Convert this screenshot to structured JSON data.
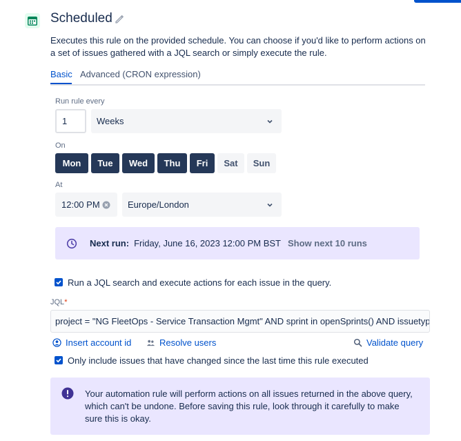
{
  "header": {
    "title": "Scheduled",
    "icon": "calendar-icon",
    "description": "Executes this rule on the provided schedule. You can choose if you'd like to perform actions on a set of issues gathered with a JQL search or simply execute the rule."
  },
  "tabs": [
    {
      "label": "Basic",
      "active": true
    },
    {
      "label": "Advanced (CRON expression)",
      "active": false
    }
  ],
  "schedule": {
    "run_every_label": "Run rule every",
    "interval_value": "1",
    "interval_unit": "Weeks",
    "on_label": "On",
    "days": [
      {
        "label": "Mon",
        "selected": true
      },
      {
        "label": "Tue",
        "selected": true
      },
      {
        "label": "Wed",
        "selected": true
      },
      {
        "label": "Thu",
        "selected": true
      },
      {
        "label": "Fri",
        "selected": true
      },
      {
        "label": "Sat",
        "selected": false
      },
      {
        "label": "Sun",
        "selected": false
      }
    ],
    "at_label": "At",
    "time": "12:00 PM",
    "timezone": "Europe/London"
  },
  "next_run": {
    "label": "Next run:",
    "value": "Friday, June 16, 2023 12:00 PM BST",
    "link": "Show next 10 runs"
  },
  "jql": {
    "checkbox_label": "Run a JQL search and execute actions for each issue in the query.",
    "checkbox_checked": true,
    "label": "JQL",
    "required_marker": "*",
    "value": "project = \"NG FleetOps - Service Transaction Mgmt\" AND sprint in openSprints() AND issuetype i",
    "insert_account_id": "Insert account id",
    "resolve_users": "Resolve users",
    "validate_query": "Validate query",
    "only_changed_label": "Only include issues that have changed since the last time this rule executed",
    "only_changed_checked": true
  },
  "warning": {
    "text": "Your automation rule will perform actions on all issues returned in the above query, which can't be undone. Before saving this rule, look through it carefully to make sure this is okay."
  },
  "colors": {
    "primary": "#0052cc",
    "day_selected": "#253858",
    "panel_purple": "#eae6ff",
    "text": "#172b4d"
  }
}
